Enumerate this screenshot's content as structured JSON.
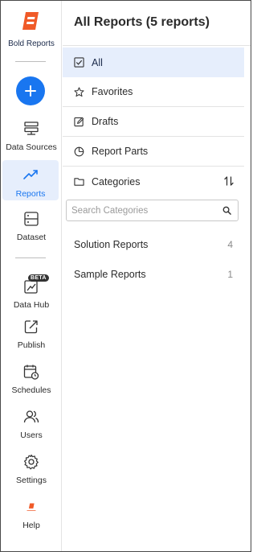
{
  "app": {
    "brand_name": "Bold Reports",
    "accent_color": "#1976f0",
    "logo_color": "#f05a28"
  },
  "rail": {
    "add_button_icon": "plus-icon",
    "items": [
      {
        "label": "Data Sources",
        "icon": "data-sources-icon",
        "active": false
      },
      {
        "label": "Reports",
        "icon": "trend-chart-icon",
        "active": true
      },
      {
        "label": "Dataset",
        "icon": "dataset-icon",
        "active": false
      },
      {
        "label": "Data Hub",
        "icon": "data-hub-icon",
        "active": false,
        "badge": "BETA"
      },
      {
        "label": "Publish",
        "icon": "publish-icon",
        "active": false
      },
      {
        "label": "Schedules",
        "icon": "calendar-clock-icon",
        "active": false
      },
      {
        "label": "Users",
        "icon": "users-icon",
        "active": false
      },
      {
        "label": "Settings",
        "icon": "gear-icon",
        "active": false
      },
      {
        "label": "Help",
        "icon": "bold-reports-small-logo",
        "active": false
      }
    ]
  },
  "header": {
    "title": "All Reports (5 reports)"
  },
  "menu": {
    "items": [
      {
        "label": "All",
        "icon": "checkbox-icon",
        "active": true
      },
      {
        "label": "Favorites",
        "icon": "star-icon",
        "active": false
      },
      {
        "label": "Drafts",
        "icon": "edit-icon",
        "active": false
      },
      {
        "label": "Report Parts",
        "icon": "pie-chart-icon",
        "active": false
      },
      {
        "label": "Categories",
        "icon": "folder-icon",
        "active": false
      }
    ],
    "sort_icon": "sort-icon"
  },
  "search": {
    "placeholder": "Search Categories",
    "value": ""
  },
  "categories": [
    {
      "name": "Solution Reports",
      "count": "4"
    },
    {
      "name": "Sample Reports",
      "count": "1"
    }
  ]
}
